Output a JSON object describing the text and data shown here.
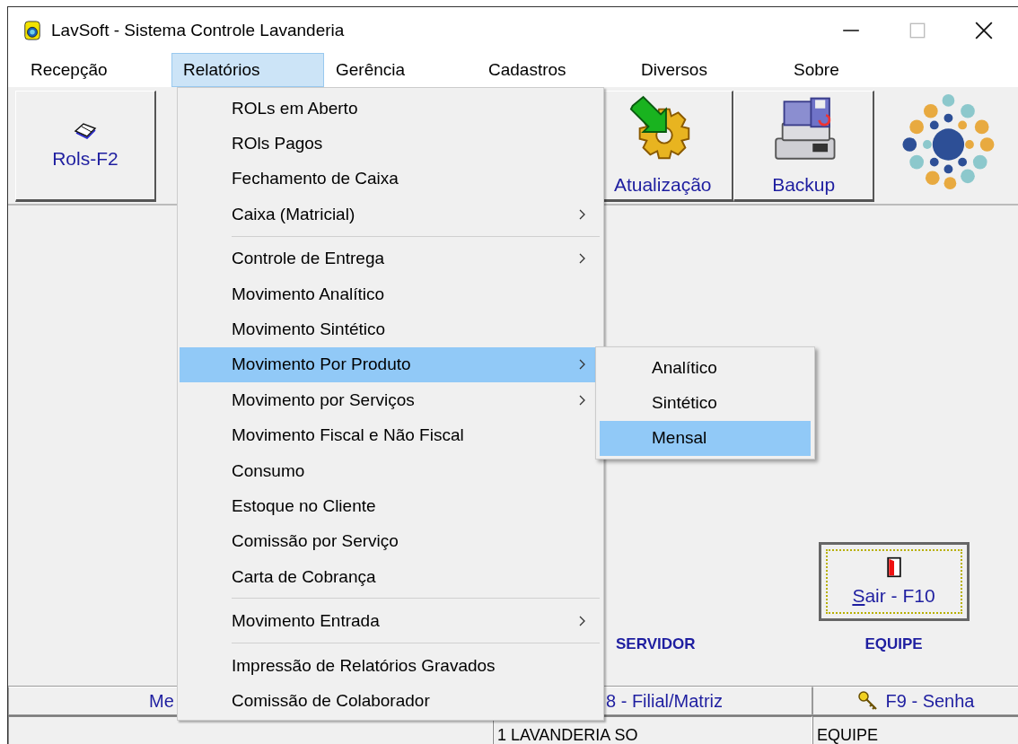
{
  "window": {
    "title": "LavSoft - Sistema Controle Lavanderia"
  },
  "menu_bar": [
    {
      "label": "Recepção",
      "selected": false
    },
    {
      "label": "Relatórios",
      "selected": true
    },
    {
      "label": "Gerência",
      "selected": false
    },
    {
      "label": "Cadastros",
      "selected": false
    },
    {
      "label": "Diversos",
      "selected": false
    },
    {
      "label": "Sobre",
      "selected": false
    }
  ],
  "dropdown": {
    "groups": [
      [
        {
          "label": "ROLs em Aberto",
          "submenu": false,
          "selected": false
        },
        {
          "label": "ROls Pagos",
          "submenu": false,
          "selected": false
        },
        {
          "label": "Fechamento de Caixa",
          "submenu": false,
          "selected": false
        },
        {
          "label": "Caixa (Matricial)",
          "submenu": true,
          "selected": false
        }
      ],
      [
        {
          "label": "Controle de Entrega",
          "submenu": true,
          "selected": false
        },
        {
          "label": "Movimento Analítico",
          "submenu": false,
          "selected": false
        },
        {
          "label": "Movimento Sintético",
          "submenu": false,
          "selected": false
        },
        {
          "label": "Movimento Por Produto",
          "submenu": true,
          "selected": true
        },
        {
          "label": "Movimento por Serviços",
          "submenu": true,
          "selected": false
        },
        {
          "label": "Movimento Fiscal e Não Fiscal",
          "submenu": false,
          "selected": false
        },
        {
          "label": "Consumo",
          "submenu": false,
          "selected": false
        },
        {
          "label": "Estoque no Cliente",
          "submenu": false,
          "selected": false
        },
        {
          "label": "Comissão por Serviço",
          "submenu": false,
          "selected": false
        },
        {
          "label": "Carta de Cobrança",
          "submenu": false,
          "selected": false
        }
      ],
      [
        {
          "label": "Movimento Entrada",
          "submenu": true,
          "selected": false
        }
      ],
      [
        {
          "label": "Impressão de Relatórios Gravados",
          "submenu": false,
          "selected": false
        },
        {
          "label": "Comissão de Colaborador",
          "submenu": false,
          "selected": false
        }
      ]
    ]
  },
  "submenu": {
    "items": [
      {
        "label": "Analítico",
        "selected": false
      },
      {
        "label": "Sintético",
        "selected": false
      },
      {
        "label": "Mensal",
        "selected": true
      }
    ]
  },
  "toolbar": {
    "left_buttons": [
      {
        "label": "Rols-F2",
        "kind": "book"
      }
    ],
    "right_buttons": [
      {
        "label": "Atualização",
        "kind": "gear"
      },
      {
        "label": "Backup",
        "kind": "backup"
      }
    ]
  },
  "main": {
    "server_label": "SERVIDOR",
    "exit_button": "Sair - F10",
    "team_label": "EQUIPE"
  },
  "status_bar": {
    "row_1": [
      "Me",
      "8 - Filial/Matriz",
      "F9 - Senha"
    ],
    "row_2": [
      "1 LAVANDERIA SO",
      "EQUIPE"
    ]
  }
}
